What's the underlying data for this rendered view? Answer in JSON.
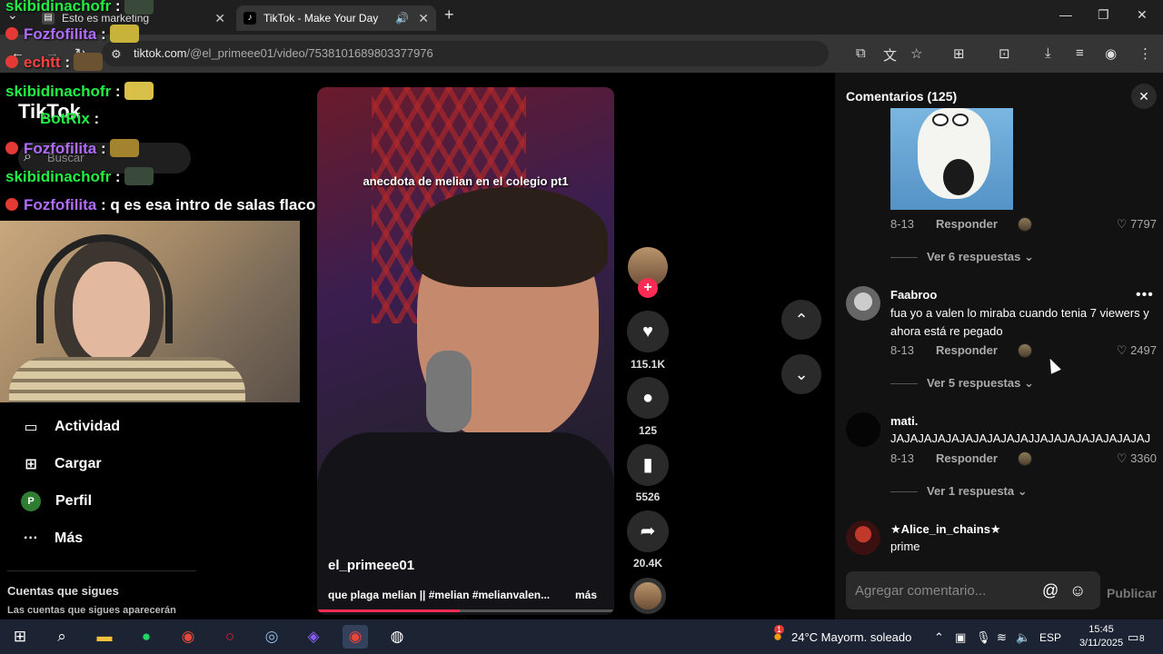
{
  "browser": {
    "tabs": [
      {
        "title": "Esto es marketing",
        "icon": "generic-page-icon"
      },
      {
        "title": "TikTok - Make Your Day",
        "icon": "tiktok-icon",
        "audio": true
      }
    ],
    "url_domain": "tiktok.com",
    "url_path": "/@el_primeee01/video/7538101689803377976"
  },
  "chat": [
    {
      "user": "skibidinachofr",
      "sep": " :",
      "text": ""
    },
    {
      "user": "Fozfofilita",
      "sep": " :",
      "text": ""
    },
    {
      "user": "echtt",
      "sep": " :",
      "text": ""
    },
    {
      "user": "skibidinachofr",
      "sep": " :",
      "text": ""
    },
    {
      "user": "BotRix",
      "sep": " :",
      "text": ""
    },
    {
      "user": "Fozfofilita",
      "sep": " :",
      "text": ""
    },
    {
      "user": "skibidinachofr",
      "sep": " :",
      "text": ""
    },
    {
      "user": "Fozfofilita",
      "sep": " :",
      "text": " q es esa intro de salas flaco"
    }
  ],
  "sidebar": {
    "logo": "TikTok",
    "search_placeholder": "Buscar",
    "items": [
      {
        "label": "Actividad",
        "icon": "activity-icon"
      },
      {
        "label": "Cargar",
        "icon": "upload-icon"
      },
      {
        "label": "Perfil",
        "icon": "profile-icon",
        "badge": "P"
      },
      {
        "label": "Más",
        "icon": "more-icon"
      }
    ],
    "following_title": "Cuentas que sigues",
    "following_sub": "Las cuentas que sigues aparecerán"
  },
  "video": {
    "caption": "anecdota de melian en el colegio pt1",
    "author": "el_primeee01",
    "description": "que plaga melian || #melian #melianvalen...",
    "more": "más",
    "progress": 0.48
  },
  "actions": {
    "likes": "115.1K",
    "comments": "125",
    "saves": "5526",
    "shares": "20.4K"
  },
  "comments": {
    "title": "Comentarios (125)",
    "items": [
      {
        "date": "8-13",
        "reply": "Responder",
        "likes": "7797",
        "view": "Ver 6 respuestas"
      },
      {
        "user": "Faabroo",
        "text": "fua yo a valen lo miraba cuando tenia 7 viewers y ahora está re pegado",
        "date": "8-13",
        "reply": "Responder",
        "likes": "2497",
        "view": "Ver 5 respuestas"
      },
      {
        "user": "mati.",
        "text": "JAJAJAJAJAJAJAJAJAJAJJAJAJAJAJAJAJAJAJ",
        "date": "8-13",
        "reply": "Responder",
        "likes": "3360",
        "view": "Ver 1 respuesta"
      },
      {
        "user": "★Alice_in_chains★",
        "text": "prime"
      }
    ],
    "input_placeholder": "Agregar comentario...",
    "publish": "Publicar"
  },
  "taskbar": {
    "weather": "24°C  Mayorm. soleado",
    "lang": "ESP",
    "time": "15:45",
    "date": "3/11/2025",
    "notif_count": "8",
    "weather_badge": "1"
  },
  "colors": {
    "accent": "#fe2c55",
    "panel_bg": "#121212",
    "taskbar_bg": "#1c2433"
  }
}
